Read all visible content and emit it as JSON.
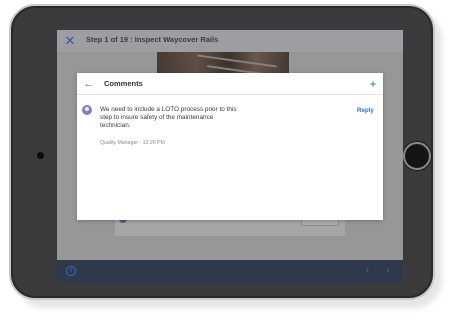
{
  "header": {
    "step_title": "Step 1 of 19 : Inspect Waycover Rails"
  },
  "dialog": {
    "title": "Comments",
    "comments": [
      {
        "text": "We need to include a LOTO process prior to this step to insure safety of the maintenance technician.",
        "author_time": "Quality Manager - 12:26 PM",
        "reply_label": "Reply"
      }
    ]
  },
  "icons": {
    "close": "close-icon",
    "back": "arrow-left-icon",
    "add": "plus-icon",
    "info": "info-icon",
    "prev": "chevron-left-icon",
    "next": "chevron-right-icon"
  },
  "colors": {
    "accent": "#2f6fd3",
    "bottom_bar": "#2e3a4a",
    "avatar": "#8a78c9"
  }
}
